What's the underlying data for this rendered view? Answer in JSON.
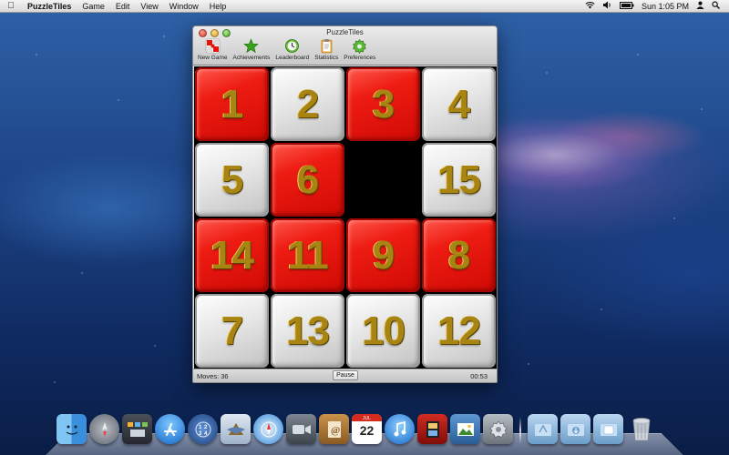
{
  "menubar": {
    "app_name": "PuzzleTiles",
    "menus": [
      "Game",
      "Edit",
      "View",
      "Window",
      "Help"
    ],
    "clock": "Sun 1:05 PM"
  },
  "window": {
    "title": "PuzzleTiles",
    "toolbar": [
      {
        "label": "New Game",
        "icon": "new-game-icon"
      },
      {
        "label": "Achievements",
        "icon": "star-icon"
      },
      {
        "label": "Leaderboard",
        "icon": "clock-icon"
      },
      {
        "label": "Statistics",
        "icon": "clipboard-icon"
      },
      {
        "label": "Preferences",
        "icon": "gear-icon"
      }
    ]
  },
  "board": {
    "tiles": [
      {
        "number": "1",
        "color": "red"
      },
      {
        "number": "2",
        "color": "white"
      },
      {
        "number": "3",
        "color": "red"
      },
      {
        "number": "4",
        "color": "white"
      },
      {
        "number": "5",
        "color": "white"
      },
      {
        "number": "6",
        "color": "red"
      },
      {
        "number": "",
        "color": "empty"
      },
      {
        "number": "15",
        "color": "white"
      },
      {
        "number": "14",
        "color": "red"
      },
      {
        "number": "11",
        "color": "red"
      },
      {
        "number": "9",
        "color": "red"
      },
      {
        "number": "8",
        "color": "red"
      },
      {
        "number": "7",
        "color": "white"
      },
      {
        "number": "13",
        "color": "white"
      },
      {
        "number": "10",
        "color": "white"
      },
      {
        "number": "12",
        "color": "white"
      }
    ],
    "colors": {
      "red": "#e8120a",
      "white": "#e8e8e8",
      "digit": "#a88412",
      "empty": "#000000"
    }
  },
  "status": {
    "moves": "Moves:  36",
    "pause_label": "Pause",
    "timer": "00:53"
  },
  "dock": {
    "calendar_month": "JUL",
    "calendar_day": "22",
    "items": [
      "finder-icon",
      "launchpad-icon",
      "mission-control-icon",
      "app-store-icon",
      "dashboard-icon",
      "mail-icon",
      "safari-icon",
      "facetime-icon",
      "address-book-icon",
      "calendar-icon",
      "itunes-icon",
      "photo-booth-icon",
      "iphoto-icon",
      "system-preferences-icon",
      "applications-folder-icon",
      "downloads-folder-icon",
      "documents-folder-icon",
      "trash-icon"
    ]
  }
}
